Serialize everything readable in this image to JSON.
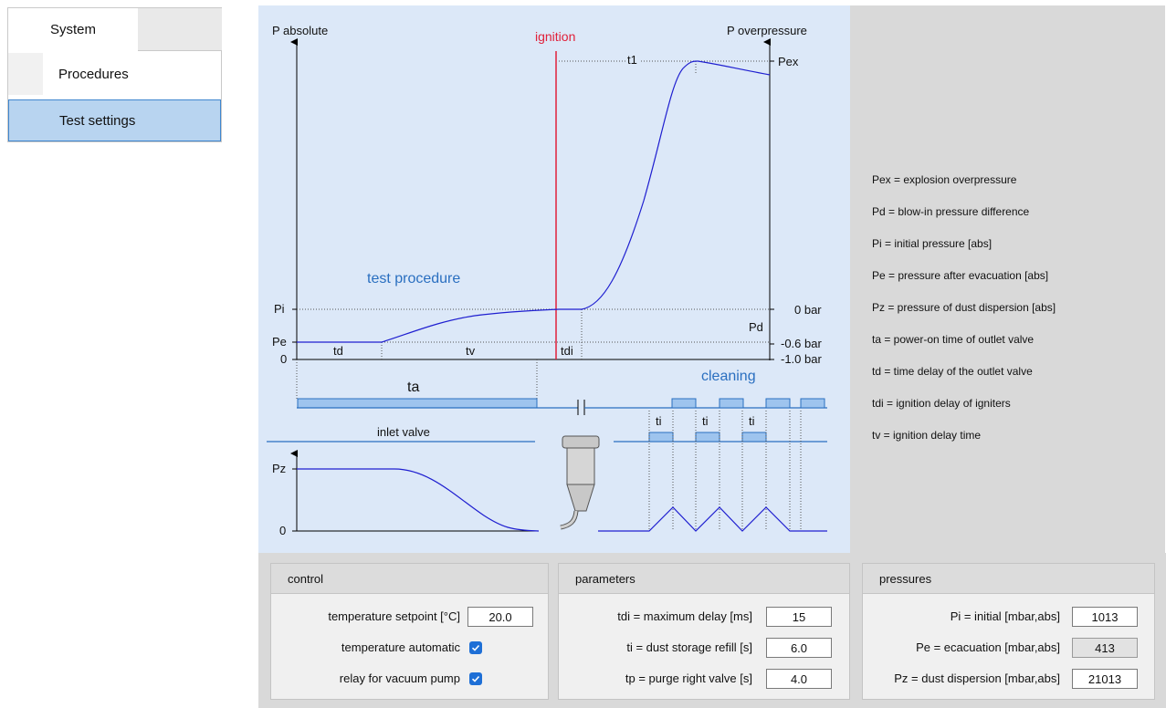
{
  "nav": {
    "tab_label": "System",
    "items": [
      {
        "label": "Procedures",
        "selected": false
      },
      {
        "label": "Test settings",
        "selected": true
      }
    ]
  },
  "diagram": {
    "left_axis_label": "P absolute",
    "right_axis_label": "P overpressure",
    "ignition_label": "ignition",
    "t1_label": "t1",
    "pex_label": "Pex",
    "pi_label": "Pi",
    "pe_label": "Pe",
    "zero_label": "0",
    "zero_bar_label": "0 bar",
    "pd_label": "Pd",
    "minus06_label": "-0.6 bar",
    "minus10_label": "-1.0 bar",
    "td_label": "td",
    "tv_label": "tv",
    "tdi_label": "tdi",
    "test_procedure_label": "test procedure",
    "cleaning_label": "cleaning",
    "ta_label": "ta",
    "inlet_valve_label": "inlet valve",
    "ti_label": "ti",
    "pz_label": "Pz",
    "zero2_label": "0",
    "colors": {
      "curve": "#1f1fd0",
      "ignition": "#e0203a",
      "accent_text": "#2a6fc0",
      "pulse": "#9ec4ee"
    }
  },
  "legend": [
    "Pex = explosion overpressure",
    "Pd  = blow-in pressure difference",
    "Pi  = initial pressure [abs]",
    "Pe  = pressure after evacuation [abs]",
    "Pz  = pressure of dust dispersion [abs]",
    "ta   = power-on time of outlet valve",
    "td   = time delay of the outlet valve",
    "tdi  = ignition delay of igniters",
    "tv   = ignition delay time"
  ],
  "control": {
    "title": "control",
    "temp_setpoint_label": "temperature setpoint  [°C]",
    "temp_setpoint_value": "20.0",
    "temp_auto_label": "temperature automatic",
    "temp_auto_checked": true,
    "relay_label": "relay for vacuum pump",
    "relay_checked": true
  },
  "parameters": {
    "title": "parameters",
    "tdi_label": "tdi = maximum delay  [ms]",
    "tdi_value": "15",
    "ti_label": "ti = dust storage refill  [s]",
    "ti_value": "6.0",
    "tp_label": "tp = purge right valve  [s]",
    "tp_value": "4.0"
  },
  "pressures": {
    "title": "pressures",
    "pi_label": "Pi = initial  [mbar,abs]",
    "pi_value": "1013",
    "pe_label": "Pe = ecacuation  [mbar,abs]",
    "pe_value": "413",
    "pz_label": "Pz = dust dispersion  [mbar,abs]",
    "pz_value": "21013"
  }
}
